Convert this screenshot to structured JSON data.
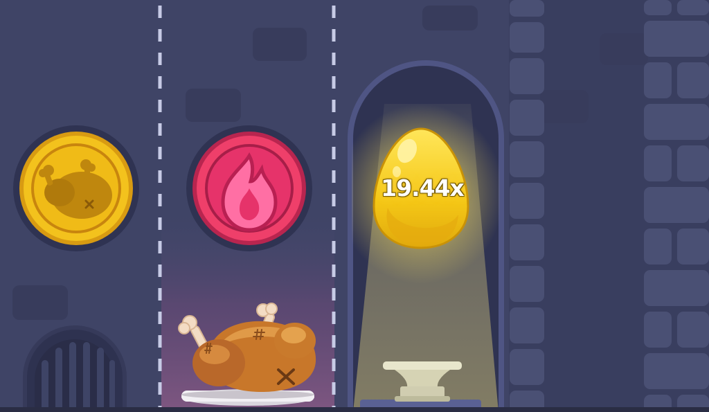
{
  "game": {
    "columns": [
      {
        "index": 0,
        "state": "passed",
        "coin": "chicken-coin-gold"
      },
      {
        "index": 1,
        "state": "current",
        "coin": "fire-coin-pink"
      },
      {
        "index": 2,
        "state": "next",
        "reward": "golden-egg",
        "multiplier": "19.44x"
      }
    ]
  },
  "colors": {
    "wall": "#3f4466",
    "wall_right": "#363a5a",
    "brick": "#4a5074",
    "lane_line": "#c7cbe6",
    "gold_coin": "#f2c21b",
    "fire_coin": "#e63a6a",
    "egg": "#f6d020",
    "glow": "#fff1a8"
  }
}
